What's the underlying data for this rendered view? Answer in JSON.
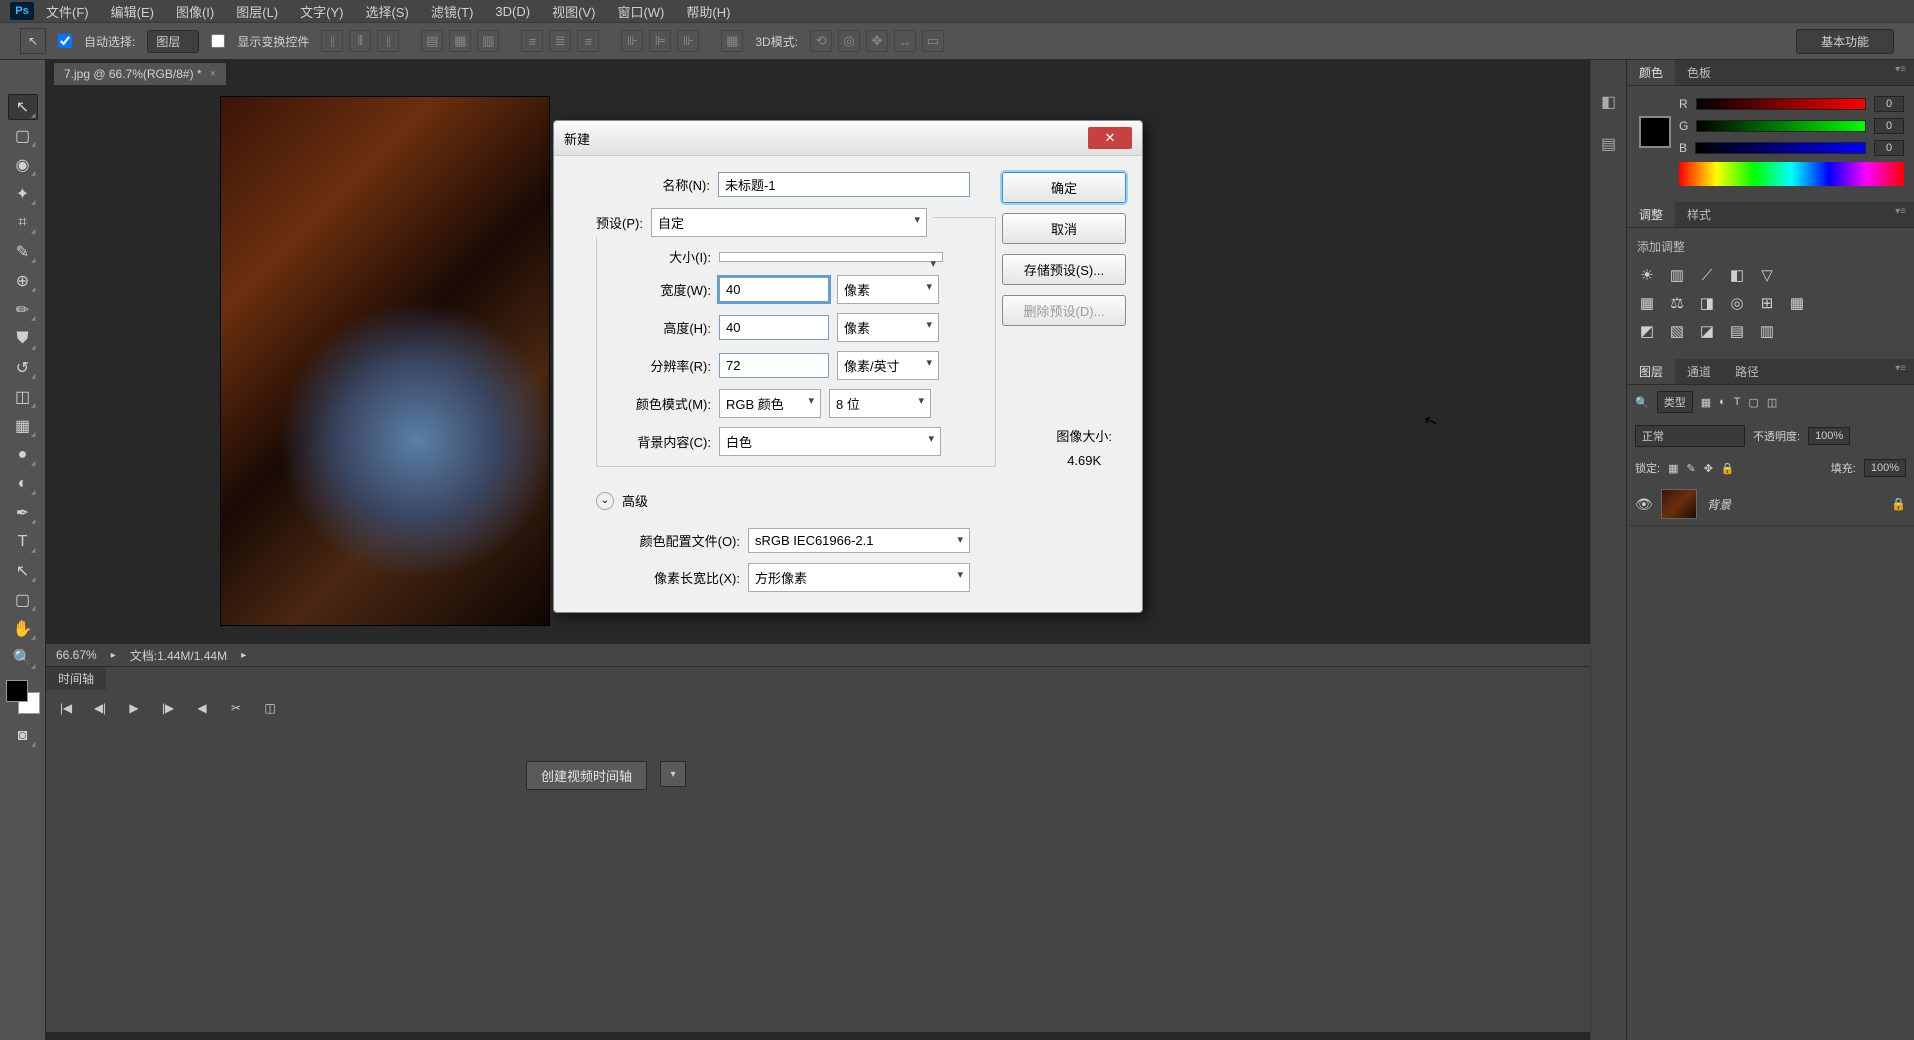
{
  "menubar": {
    "items": [
      "文件(F)",
      "编辑(E)",
      "图像(I)",
      "图层(L)",
      "文字(Y)",
      "选择(S)",
      "滤镜(T)",
      "3D(D)",
      "视图(V)",
      "窗口(W)",
      "帮助(H)"
    ]
  },
  "optbar": {
    "auto_select": "自动选择:",
    "auto_select_value": "图层",
    "show_transform": "显示变换控件",
    "mode3d": "3D模式:",
    "workspace": "基本功能"
  },
  "doc_tab": {
    "title": "7.jpg @ 66.7%(RGB/8#) *"
  },
  "status": {
    "zoom": "66.67%",
    "docinfo": "文档:1.44M/1.44M"
  },
  "timeline": {
    "tab": "时间轴",
    "video_btn": "创建视频时间轴"
  },
  "panels": {
    "color_tabs": [
      "颜色",
      "色板"
    ],
    "rgb": {
      "r_label": "R",
      "g_label": "G",
      "b_label": "B",
      "r": "0",
      "g": "0",
      "b": "0"
    },
    "adjust_tabs": [
      "调整",
      "样式"
    ],
    "adjust_label": "添加调整",
    "layer_tabs": [
      "图层",
      "通道",
      "路径"
    ],
    "kind_label": "类型",
    "blend": "正常",
    "opacity_label": "不透明度:",
    "opacity": "100%",
    "lock_label": "锁定:",
    "fill_label": "填充:",
    "fill": "100%",
    "bg_layer": "背景"
  },
  "dialog": {
    "title": "新建",
    "name_label": "名称(N):",
    "name_value": "未标题-1",
    "preset_label": "预设(P):",
    "preset_value": "自定",
    "size_label": "大小(I):",
    "size_value": "",
    "width_label": "宽度(W):",
    "width_value": "40",
    "width_unit": "像素",
    "height_label": "高度(H):",
    "height_value": "40",
    "height_unit": "像素",
    "res_label": "分辨率(R):",
    "res_value": "72",
    "res_unit": "像素/英寸",
    "mode_label": "颜色模式(M):",
    "mode_value": "RGB 颜色",
    "depth_value": "8 位",
    "bg_label": "背景内容(C):",
    "bg_value": "白色",
    "adv_label": "高级",
    "profile_label": "颜色配置文件(O):",
    "profile_value": "sRGB IEC61966-2.1",
    "aspect_label": "像素长宽比(X):",
    "aspect_value": "方形像素",
    "ok": "确定",
    "cancel": "取消",
    "save_preset": "存储预设(S)...",
    "del_preset": "删除预设(D)...",
    "imgsize_label": "图像大小:",
    "imgsize_value": "4.69K"
  }
}
